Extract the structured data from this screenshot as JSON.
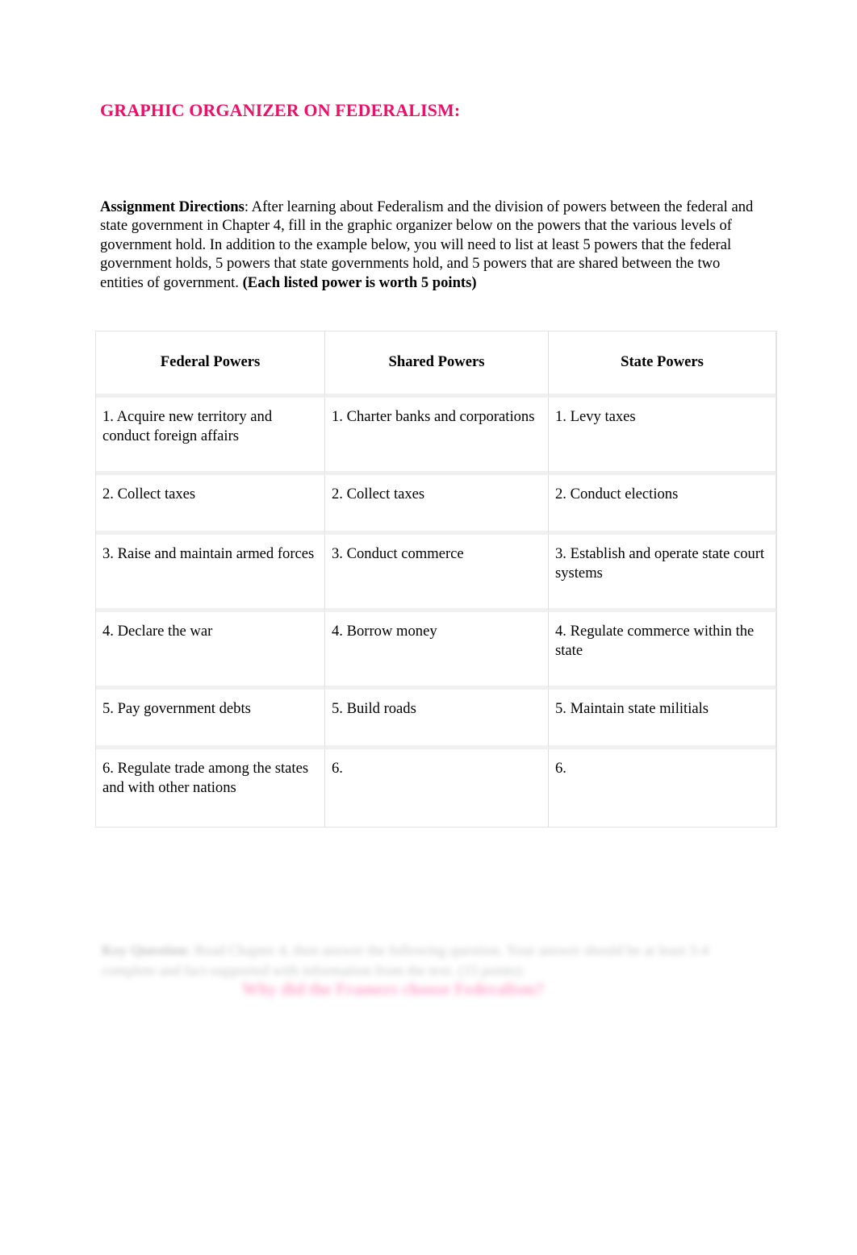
{
  "document": {
    "title": "GRAPHIC ORGANIZER ON FEDERALISM:",
    "title_color": "#ED0F69"
  },
  "directions": {
    "label": "Assignment Directions",
    "body": ": After learning about Federalism and the division of powers between the federal and state government in Chapter 4, fill in the graphic organizer below on the powers that the various levels of government hold. In addition to the example below, you will need to list at least 5 powers that the federal government holds, 5 powers that state governments hold, and 5 powers that are shared between the two entities of government.   ",
    "points_note": "(Each listed power is worth 5 points)"
  },
  "table": {
    "headers": [
      "Federal Powers",
      "Shared Powers",
      "State Powers"
    ],
    "rows": [
      {
        "federal": " 1. Acquire new territory and conduct foreign affairs",
        "shared": " 1. Charter banks and corporations",
        "state": "1. Levy taxes"
      },
      {
        "federal": " 2. Collect taxes",
        "shared": " 2. Collect taxes",
        "state": " 2. Conduct elections"
      },
      {
        "federal": "3. Raise and maintain armed forces",
        "shared": " 3. Conduct commerce",
        "state": " 3. Establish and operate state court systems"
      },
      {
        "federal": "4. Declare the war",
        "shared": " 4. Borrow money",
        "state": " 4. Regulate commerce within the state"
      },
      {
        "federal": "5. Pay government debts",
        "shared": " 5. Build roads",
        "state": " 5. Maintain state militials"
      },
      {
        "federal": "6. Regulate trade among the states and with other nations",
        "shared": "6.",
        "state": "6."
      }
    ]
  },
  "footer": {
    "blurred_label": "Key Question",
    "blurred_body": ":   Read Chapter 4, then answer the following question. Your answer should be at least 3-4 complete and fact-supported with information from the text.  (15 points)",
    "blurred_pink": "Why did the Framers choose Federalism?"
  }
}
